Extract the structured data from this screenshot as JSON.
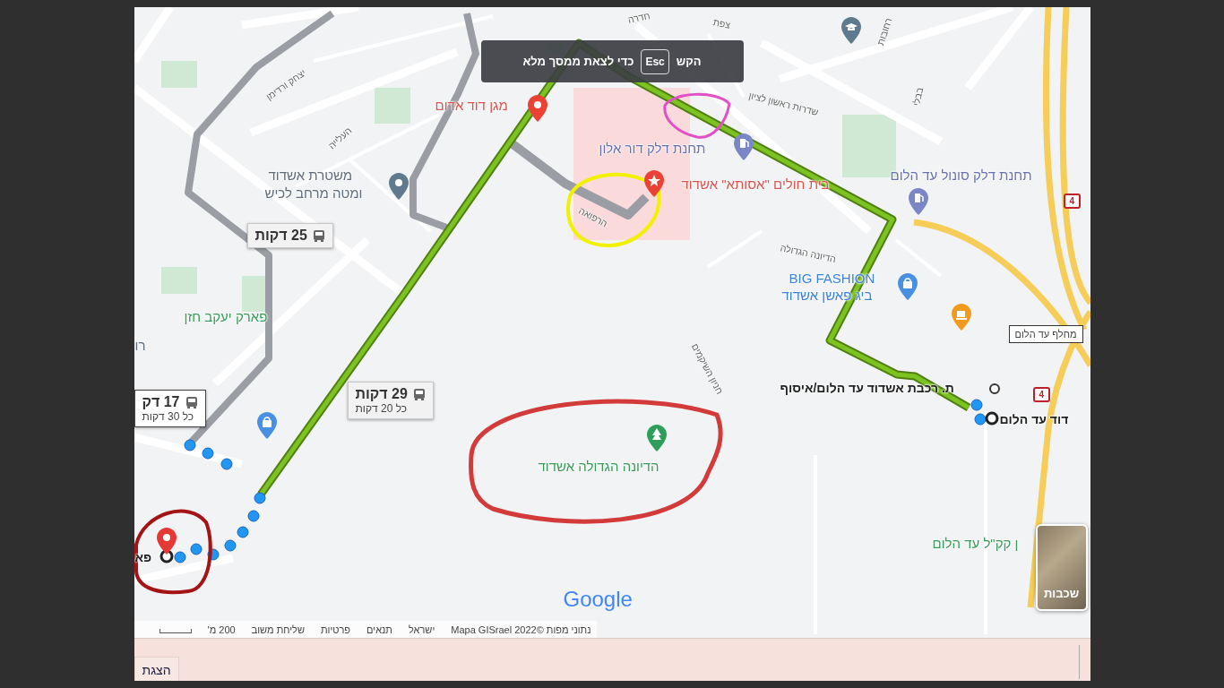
{
  "fullscreen_hint": {
    "before": "הקש",
    "key": "Esc",
    "after": "כדי לצאת ממסך מלא"
  },
  "map": {
    "labels": [
      {
        "kind": "health",
        "text": "מגן דוד אדום"
      },
      {
        "kind": "service",
        "text": "משטרת אשדוד"
      },
      {
        "kind": "service",
        "text": "ומטה מרחב לכיש"
      },
      {
        "kind": "fuel",
        "text": "תחנת דלק דור אלון"
      },
      {
        "kind": "health",
        "text": "בית חולים \"אסותא\" אשדוד"
      },
      {
        "kind": "fuel",
        "text": "תחנת דלק סונול עד הלום"
      },
      {
        "kind": "shopping",
        "text": "BIG FASHION"
      },
      {
        "kind": "shopping",
        "text": "ביג פאשן אשדוד"
      },
      {
        "kind": "park",
        "text": "פארק יעקב חזן"
      },
      {
        "kind": "park",
        "text": "הדיונה הגדולה אשדוד"
      },
      {
        "kind": "transit",
        "text": "ת. רכבת אשדוד עד הלום/איסוף"
      },
      {
        "kind": "transit",
        "text": "דוד עד הלום"
      },
      {
        "kind": "park",
        "text": "ן קק\"ל עד הלום"
      },
      {
        "kind": "transit",
        "text": "פא"
      },
      {
        "kind": "service",
        "text": "רו"
      },
      {
        "kind": "street",
        "text": "חדרה"
      },
      {
        "kind": "street",
        "text": "צפת"
      },
      {
        "kind": "street",
        "text": "שדרות ראשון לציון"
      },
      {
        "kind": "street",
        "text": "רחובות"
      },
      {
        "kind": "street",
        "text": "בבלי"
      },
      {
        "kind": "street",
        "text": "הדיונה הגדולה"
      },
      {
        "kind": "street",
        "text": "חניון השיקמים"
      },
      {
        "kind": "street",
        "text": "יצחק ורדימן"
      },
      {
        "kind": "street",
        "text": "העלייה"
      },
      {
        "kind": "street",
        "text": "הרפואה"
      }
    ],
    "route_badges": [
      {
        "duration": "25 דקות",
        "selected": false
      },
      {
        "duration": "29 דקות",
        "frequency": "כל 20 דקות",
        "selected": false
      },
      {
        "duration": "17 דק",
        "frequency": "כל 30 דקות",
        "selected": true
      }
    ],
    "interchange_label": "מחלף עד הלום",
    "road_shields": [
      "4",
      "4"
    ],
    "logo": "Google",
    "layers_button": "שכבות",
    "footer": {
      "attribution": "נתוני מפות ©2022 Mapa GISrael",
      "links": [
        "ישראל",
        "תנאים",
        "פרטיות",
        "שליחת משוב"
      ],
      "scale": "200 מ'"
    }
  },
  "bottom_panel": {
    "button": "הצגת"
  }
}
